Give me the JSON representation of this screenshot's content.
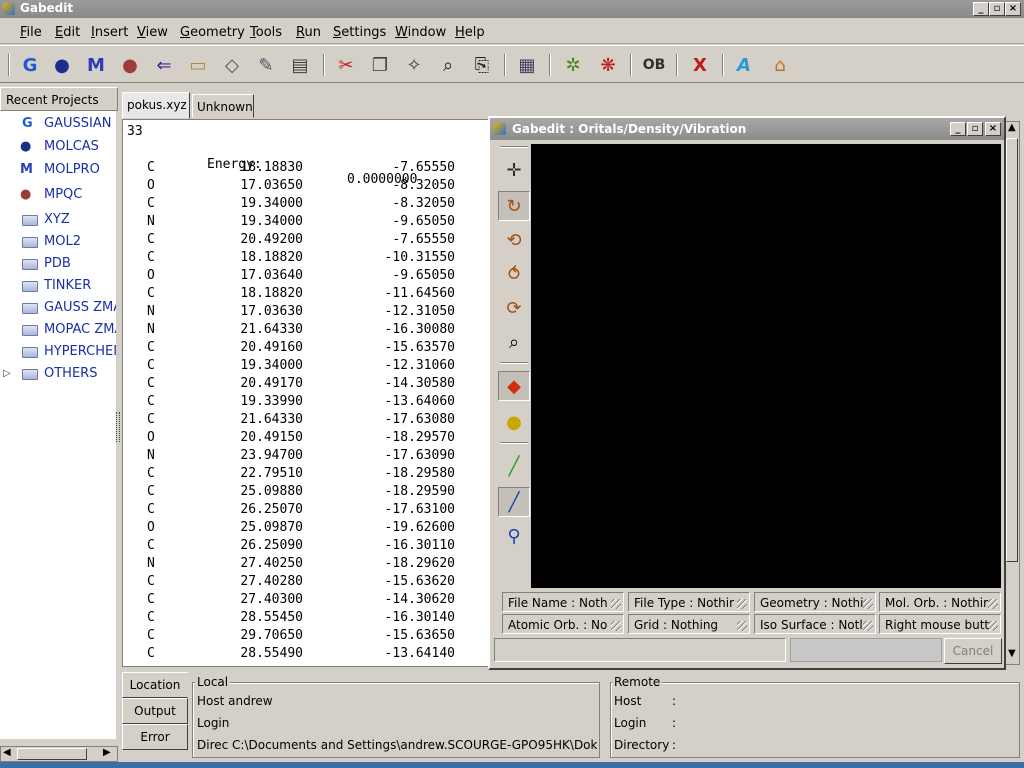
{
  "window": {
    "title": "Gabedit"
  },
  "menubar": [
    "File",
    "Edit",
    "Insert",
    "View",
    "Geometry",
    "Tools",
    "Run",
    "Settings",
    "Window",
    "Help"
  ],
  "toolbar": {
    "ob_label": "OB",
    "icons": [
      "gaussian-icon",
      "molcas-icon",
      "molpro-icon",
      "mpqc-icon",
      "import-icon",
      "open-folder-icon",
      "save-icon",
      "edit-icon",
      "print-icon",
      "cut-icon",
      "copy-icon",
      "paste-icon",
      "find-icon",
      "replace-icon",
      "molecule-editor-icon",
      "draw-molecule-icon",
      "display-orbitals-icon",
      "openbabel-icon",
      "close-icon",
      "text-icon",
      "home-icon"
    ]
  },
  "sidebar": {
    "header": "Recent Projects",
    "items": [
      {
        "label": "GAUSSIAN",
        "icon": "gaussian-icon"
      },
      {
        "label": "MOLCAS",
        "icon": "molcas-icon"
      },
      {
        "label": "MOLPRO",
        "icon": "molpro-icon"
      },
      {
        "label": "MPQC",
        "icon": "mpqc-icon"
      },
      {
        "label": "XYZ",
        "icon": "folder-icon"
      },
      {
        "label": "MOL2",
        "icon": "folder-icon"
      },
      {
        "label": "PDB",
        "icon": "folder-icon"
      },
      {
        "label": "TINKER",
        "icon": "folder-icon"
      },
      {
        "label": "GAUSS ZMAT",
        "icon": "folder-icon"
      },
      {
        "label": "MOPAC ZMAT",
        "icon": "folder-icon"
      },
      {
        "label": "HYPERCHEM",
        "icon": "folder-icon"
      },
      {
        "label": "OTHERS",
        "icon": "folder-icon"
      }
    ]
  },
  "tabs": [
    "pokus.xyz",
    "Unknown"
  ],
  "editor": {
    "line1": "33",
    "energy_label": "Energy:",
    "energy_value": "0.0000000",
    "atoms": [
      [
        "C",
        "18.18830",
        "-7.65550"
      ],
      [
        "O",
        "17.03650",
        "-8.32050"
      ],
      [
        "C",
        "19.34000",
        "-8.32050"
      ],
      [
        "N",
        "19.34000",
        "-9.65050"
      ],
      [
        "C",
        "20.49200",
        "-7.65550"
      ],
      [
        "C",
        "18.18820",
        "-10.31550"
      ],
      [
        "O",
        "17.03640",
        "-9.65050"
      ],
      [
        "C",
        "18.18820",
        "-11.64560"
      ],
      [
        "N",
        "17.03630",
        "-12.31050"
      ],
      [
        "N",
        "21.64330",
        "-16.30080"
      ],
      [
        "C",
        "20.49160",
        "-15.63570"
      ],
      [
        "C",
        "19.34000",
        "-12.31060"
      ],
      [
        "C",
        "20.49170",
        "-14.30580"
      ],
      [
        "C",
        "19.33990",
        "-13.64060"
      ],
      [
        "C",
        "21.64330",
        "-17.63080"
      ],
      [
        "O",
        "20.49150",
        "-18.29570"
      ],
      [
        "N",
        "23.94700",
        "-17.63090"
      ],
      [
        "C",
        "22.79510",
        "-18.29580"
      ],
      [
        "C",
        "25.09880",
        "-18.29590"
      ],
      [
        "C",
        "26.25070",
        "-17.63100"
      ],
      [
        "O",
        "25.09870",
        "-19.62600"
      ],
      [
        "C",
        "26.25090",
        "-16.30110"
      ],
      [
        "N",
        "27.40250",
        "-18.29620"
      ],
      [
        "C",
        "27.40280",
        "-15.63620"
      ],
      [
        "C",
        "27.40300",
        "-14.30620"
      ],
      [
        "C",
        "28.55450",
        "-16.30140"
      ],
      [
        "C",
        "29.70650",
        "-15.63650"
      ],
      [
        "C",
        "28.55490",
        "-13.64140"
      ]
    ]
  },
  "dialog": {
    "title": "Gabedit : Oritals/Density/Vibration",
    "tools": [
      "move-icon",
      "rotate-icon",
      "rotate-z-icon",
      "rotate-x-icon",
      "rotate-y-icon",
      "zoom-icon",
      "color-cube-icon",
      "sphere-icon",
      "wire-line-icon",
      "stick-icon",
      "ball-stick-icon"
    ],
    "status": {
      "file_name": "File Name : Noth",
      "file_type": "File Type : Nothir",
      "geometry": "Geometry : Nothi",
      "mol_orb": "Mol. Orb. : Nothir",
      "atomic_orb": "Atomic Orb. : No",
      "grid": "Grid : Nothing",
      "iso_surface": "Iso Surface : Notl",
      "right_mouse": "Right mouse butt"
    },
    "cancel": "Cancel"
  },
  "bottom": {
    "tabs": [
      "Location",
      "Output",
      "Error"
    ],
    "local": {
      "label": "Local",
      "host": "Host  andrew",
      "login": "Login",
      "directory": "Direc  C:\\Documents and Settings\\andrew.SCOURGE-GPO95HK\\Dok"
    },
    "remote": {
      "label": "Remote",
      "host_key": "Host",
      "login_key": "Login",
      "directory_key": "Directory",
      "sep": ":"
    }
  }
}
